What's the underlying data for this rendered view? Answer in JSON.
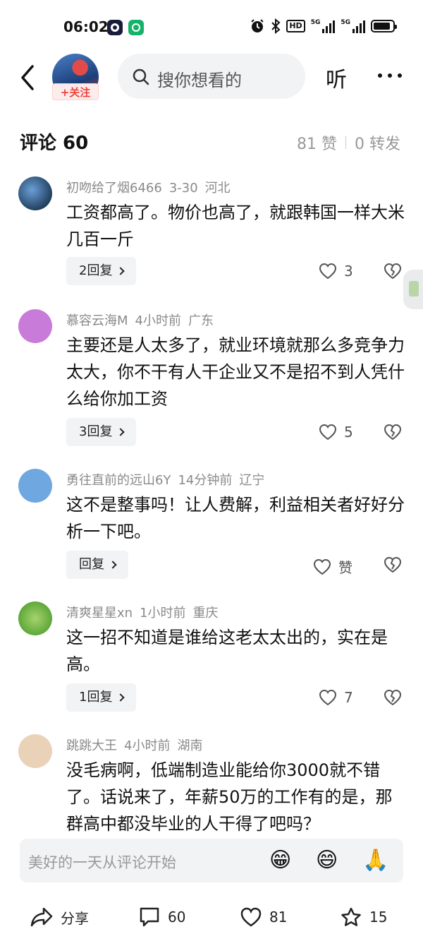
{
  "status_bar": {
    "time": "06:02",
    "icons": [
      "app-a-icon",
      "app-b-icon",
      "alarm-icon",
      "bluetooth-icon",
      "hd-icon",
      "signal-5g-icon",
      "signal-5g-icon-2",
      "battery-icon"
    ],
    "hd": "HD",
    "sig1": "5G",
    "sig2": "5G"
  },
  "header": {
    "follow_label": "+关注",
    "search_placeholder": "搜你想看的",
    "listen_label": "听"
  },
  "comments_header": {
    "title": "评论 60",
    "likes": "81 赞",
    "shares": "0 转发"
  },
  "comments": [
    {
      "user": "初吻给了烟6466",
      "time": "3-30",
      "location": "河北",
      "text": "工资都高了。物价也高了，就跟韩国一样大米几百一斤",
      "reply_label": "2回复",
      "likes": "3"
    },
    {
      "user": "慕容云海M",
      "time": "4小时前",
      "location": "广东",
      "text": "主要还是人太多了，就业环境就那么多竞争力太大，你不干有人干企业又不是招不到人凭什么给你加工资",
      "reply_label": "3回复",
      "likes": "5"
    },
    {
      "user": "勇往直前的远山6Y",
      "time": "14分钟前",
      "location": "辽宁",
      "text": "这不是整事吗！让人费解，利益相关者好好分析一下吧。",
      "reply_label": "回复",
      "likes": "赞"
    },
    {
      "user": "清爽星星xn",
      "time": "1小时前",
      "location": "重庆",
      "text": "这一招不知道是谁给这老太太出的，实在是高。",
      "reply_label": "1回复",
      "likes": "7"
    },
    {
      "user": "跳跳大王",
      "time": "4小时前",
      "location": "湖南",
      "text": "没毛病啊，低端制造业能给你3000就不错了。话说来了，年薪50万的工作有的是，那群高中都没毕业的人干得了吧吗？"
    }
  ],
  "input_bar": {
    "placeholder": "美好的一天从评论开始",
    "emojis": [
      "😁",
      "😄",
      "🙏"
    ]
  },
  "bottom_bar": {
    "share_label": "分享",
    "comment_count": "60",
    "like_count": "81",
    "favorite_count": "15"
  },
  "colors": {
    "accent_red": "#f0423b",
    "meta_gray": "#8a8a8a",
    "surface_gray": "#f2f3f5"
  }
}
